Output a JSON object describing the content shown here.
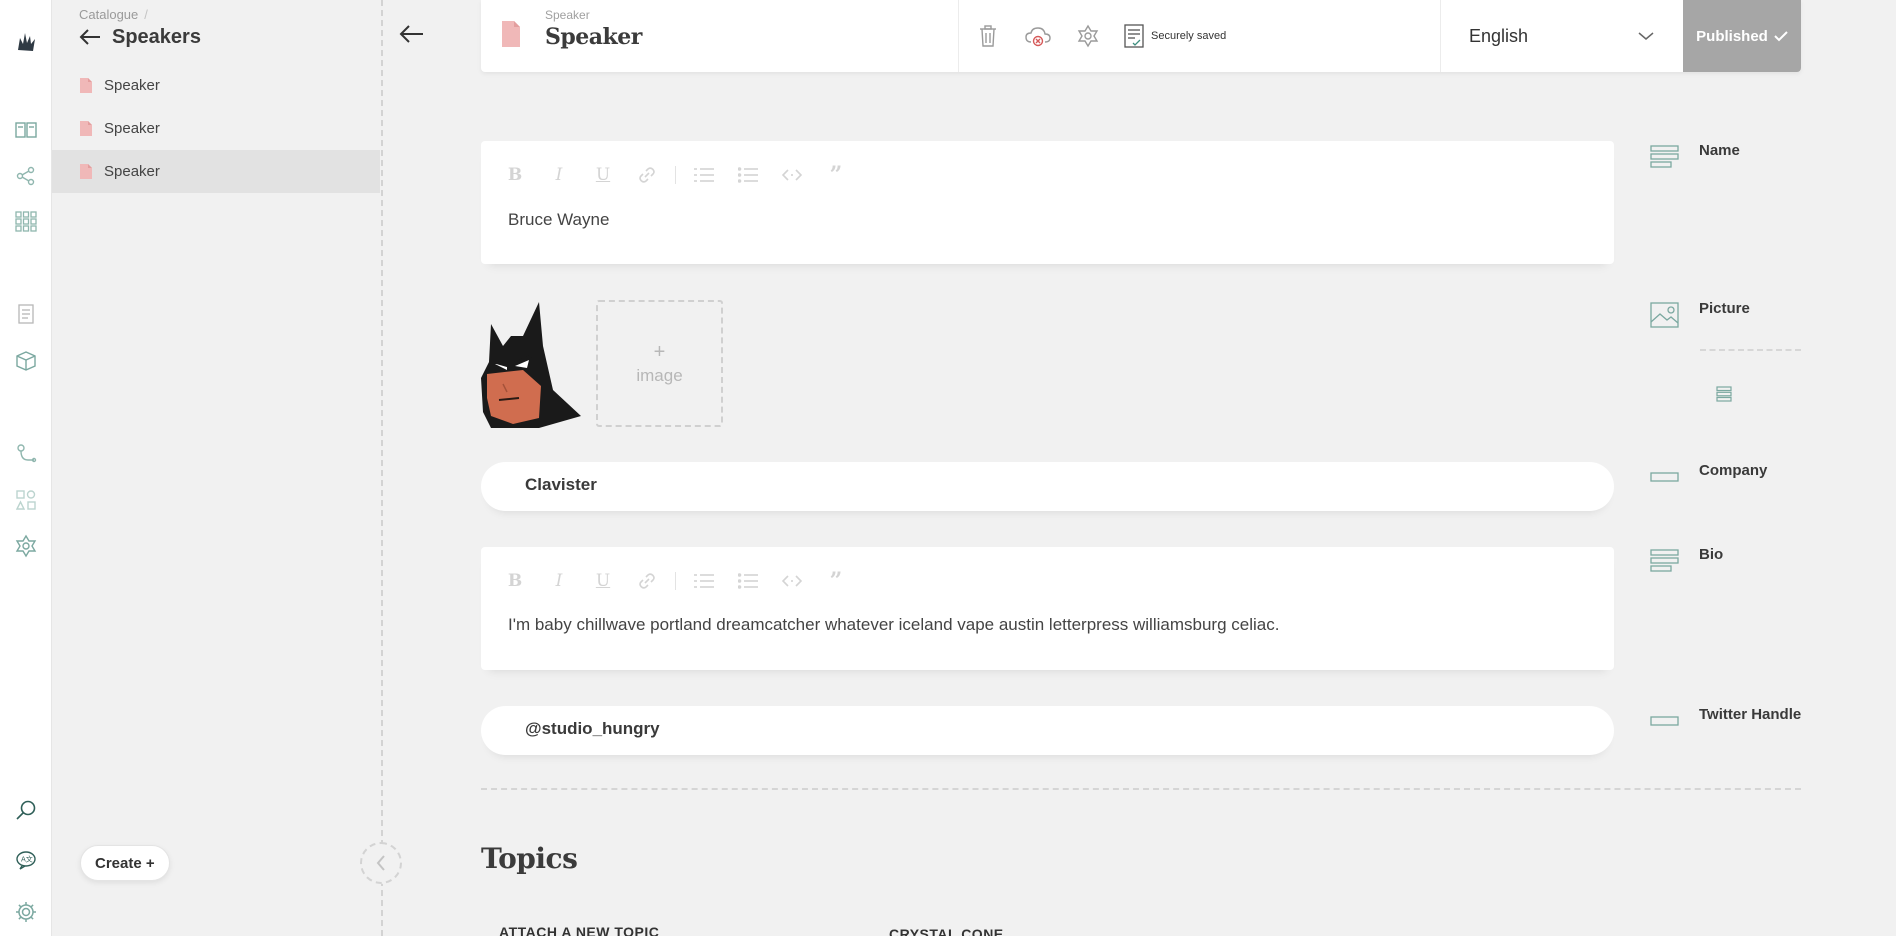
{
  "rail": {
    "icons": [
      "logo-icon",
      "catalogue-icon",
      "shapes-icon",
      "grid-icon",
      "document-icon",
      "box-icon",
      "path-icon",
      "components-icon",
      "settings-hex-icon",
      "search-icon",
      "translate-icon",
      "gear-icon"
    ]
  },
  "sidebar": {
    "breadcrumb": "Catalogue",
    "breadcrumb_sep": "/",
    "title": "Speakers",
    "items": [
      {
        "label": "Speaker"
      },
      {
        "label": "Speaker"
      },
      {
        "label": "Speaker"
      }
    ],
    "create_label": "Create +"
  },
  "header": {
    "type_label": "Speaker",
    "title": "Speaker",
    "saved_status": "Securely saved",
    "language": "English",
    "publish_label": "Published"
  },
  "fields": {
    "name": {
      "label": "Name",
      "value": "Bruce Wayne"
    },
    "picture": {
      "label": "Picture",
      "add_plus": "+",
      "add_label": "image"
    },
    "company": {
      "label": "Company",
      "value": "Clavister"
    },
    "bio": {
      "label": "Bio",
      "value": "I'm baby chillwave portland dreamcatcher whatever iceland vape austin letterpress williamsburg celiac."
    },
    "twitter": {
      "label": "Twitter Handle",
      "value": "@studio_hungry"
    }
  },
  "toolbar": {
    "buttons": [
      "bold-icon",
      "italic-icon",
      "underline-icon",
      "link-icon",
      "ordered-list-icon",
      "unordered-list-icon",
      "code-icon",
      "quote-icon"
    ]
  },
  "topics": {
    "title": "Topics",
    "attach_label": "ATTACH A NEW TOPIC",
    "topic_name": "CRYSTAL CONE"
  },
  "colors": {
    "accent_doc": "#f0b8b8",
    "publish_bg": "#a6a6a6",
    "rail_icon": "#7ba8a0"
  }
}
